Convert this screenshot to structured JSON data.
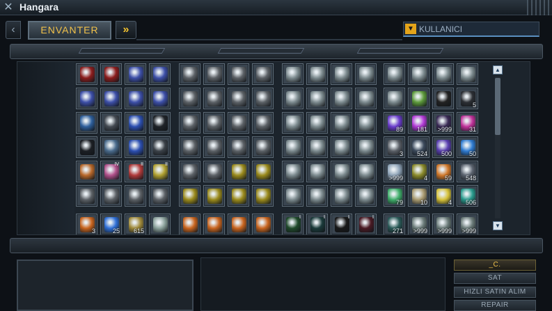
{
  "window": {
    "title": "Hangara"
  },
  "nav": {
    "tab_label": "ENVANTER",
    "prev_icon": "‹",
    "next_icon": "»"
  },
  "user_filter": {
    "label": "KULLANICI"
  },
  "actions": {
    "primary": "_C.",
    "sell": "SAT",
    "quick_buy": "HIZLI SATIN ALIM",
    "repair": "REPAIR"
  },
  "colors": {
    "accent": "#f0c14a",
    "slot_border": "#5f6d79",
    "panel": "#1c242c"
  },
  "inventory": {
    "rows": [
      [
        {
          "icon": "red-book-icon",
          "color": "#8c1d1d"
        },
        {
          "icon": "red-book-icon",
          "color": "#8c1d1d"
        },
        {
          "icon": "blue-drone-icon",
          "color": "#3d4fa8"
        },
        {
          "icon": "blue-drone-icon",
          "color": "#3d4fa8"
        },
        {
          "icon": "generator-icon",
          "color": "#5c6166"
        },
        {
          "icon": "generator-icon",
          "color": "#5c6166"
        },
        {
          "icon": "generator-icon",
          "color": "#5c6166"
        },
        {
          "icon": "generator-icon",
          "color": "#5c6166"
        },
        {
          "icon": "laser-cannon-icon",
          "color": "#7c8a8e"
        },
        {
          "icon": "laser-cannon-icon",
          "color": "#7c8a8e"
        },
        {
          "icon": "laser-cannon-icon",
          "color": "#7c8a8e"
        },
        {
          "icon": "laser-cannon-icon",
          "color": "#7c8a8e"
        },
        {
          "icon": "laser-cannon-icon",
          "color": "#7c8a8e"
        },
        {
          "icon": "laser-cannon-icon",
          "color": "#7c8a8e"
        },
        {
          "icon": "laser-cannon-icon",
          "color": "#7c8a8e"
        },
        {
          "icon": "laser-cannon-icon",
          "color": "#7c8a8e"
        }
      ],
      [
        {
          "icon": "blue-drone-icon",
          "color": "#3d4fa8"
        },
        {
          "icon": "blue-drone-icon",
          "color": "#3d4fa8"
        },
        {
          "icon": "blue-drone-icon",
          "color": "#3d4fa8"
        },
        {
          "icon": "blue-drone-icon",
          "color": "#3d4fa8"
        },
        {
          "icon": "generator-icon",
          "color": "#5c6166"
        },
        {
          "icon": "generator-icon",
          "color": "#5c6166"
        },
        {
          "icon": "generator-icon",
          "color": "#5c6166"
        },
        {
          "icon": "generator-icon",
          "color": "#5c6166"
        },
        {
          "icon": "laser-cannon-icon",
          "color": "#7c8a8e"
        },
        {
          "icon": "laser-cannon-icon",
          "color": "#7c8a8e"
        },
        {
          "icon": "laser-cannon-icon",
          "color": "#7c8a8e"
        },
        {
          "icon": "laser-cannon-icon",
          "color": "#7c8a8e"
        },
        {
          "icon": "laser-cannon-icon",
          "color": "#7c8a8e"
        },
        {
          "icon": "green-cpu-icon",
          "color": "#5d9a3b"
        },
        {
          "icon": "black-module-icon",
          "color": "#222222"
        },
        {
          "icon": "magnet-icon",
          "color": "#2c2f34",
          "count": "5"
        }
      ],
      [
        {
          "icon": "drone-formation-icon",
          "color": "#2e5f9c"
        },
        {
          "icon": "spider-drone-icon",
          "color": "#444a52"
        },
        {
          "icon": "blue-chip-icon",
          "color": "#2c4fb1"
        },
        {
          "icon": "dark-box-icon",
          "color": "#1f2328"
        },
        {
          "icon": "generator-icon",
          "color": "#5c6166"
        },
        {
          "icon": "generator-icon",
          "color": "#5c6166"
        },
        {
          "icon": "generator-icon",
          "color": "#5c6166"
        },
        {
          "icon": "generator-icon",
          "color": "#5c6166"
        },
        {
          "icon": "laser-cannon-icon",
          "color": "#7c8a8e"
        },
        {
          "icon": "laser-cannon-icon",
          "color": "#7c8a8e"
        },
        {
          "icon": "laser-cannon-icon",
          "color": "#7c8a8e"
        },
        {
          "icon": "laser-cannon-icon",
          "color": "#7c8a8e"
        },
        {
          "icon": "purple-crystal-icon",
          "color": "#6a3ccc",
          "count": "89"
        },
        {
          "icon": "violet-crystal-icon",
          "color": "#b23ad6",
          "count": "181"
        },
        {
          "icon": "dark-cargo-icon",
          "color": "#3a2a55",
          "count": ">999"
        },
        {
          "icon": "pink-crystal-icon",
          "color": "#c0329a",
          "count": "31"
        }
      ],
      [
        {
          "icon": "black-plate-icon",
          "color": "#1c1f24"
        },
        {
          "icon": "grid-chip-icon",
          "color": "#4a6b8c"
        },
        {
          "icon": "blue-chip-icon",
          "color": "#2c4fb1"
        },
        {
          "icon": "triangle-module-icon",
          "color": "#3b4148"
        },
        {
          "icon": "generator-icon",
          "color": "#5c6166"
        },
        {
          "icon": "generator-icon",
          "color": "#5c6166"
        },
        {
          "icon": "generator-icon",
          "color": "#5c6166"
        },
        {
          "icon": "generator-icon",
          "color": "#5c6166"
        },
        {
          "icon": "laser-cannon-icon",
          "color": "#7c8a8e"
        },
        {
          "icon": "laser-cannon-icon",
          "color": "#7c8a8e"
        },
        {
          "icon": "laser-cannon-icon",
          "color": "#7c8a8e"
        },
        {
          "icon": "laser-cannon-icon",
          "color": "#7c8a8e"
        },
        {
          "icon": "gray-ore-icon",
          "color": "#5a5f66",
          "count": "3"
        },
        {
          "icon": "rocket-pack-icon",
          "color": "#3c4a5c",
          "count": "524"
        },
        {
          "icon": "violet-shard-icon",
          "color": "#5a3fb0",
          "count": "500"
        },
        {
          "icon": "blue-crystal-icon",
          "color": "#2f7bd1",
          "count": "50"
        }
      ],
      [
        {
          "icon": "orange-drone-icon",
          "color": "#b8682a"
        },
        {
          "icon": "pink-ring-icon",
          "color": "#b0508a",
          "level": "IV"
        },
        {
          "icon": "red-ring-icon",
          "color": "#b03a3a",
          "level": "II"
        },
        {
          "icon": "yellow-ring-icon",
          "color": "#b0a030",
          "level": "II"
        },
        {
          "icon": "generator-icon",
          "color": "#5c6166"
        },
        {
          "icon": "generator-icon",
          "color": "#5c6166"
        },
        {
          "icon": "yellow-shield-gen-icon",
          "color": "#9a8a1c"
        },
        {
          "icon": "yellow-shield-gen-icon",
          "color": "#9a8a1c"
        },
        {
          "icon": "laser-cannon-icon",
          "color": "#7c8a8e"
        },
        {
          "icon": "laser-cannon-icon",
          "color": "#7c8a8e"
        },
        {
          "icon": "laser-cannon-icon",
          "color": "#7c8a8e"
        },
        {
          "icon": "laser-cannon-icon",
          "color": "#7c8a8e"
        },
        {
          "icon": "white-star-icon",
          "color": "#8fa4b8",
          "count": ">999"
        },
        {
          "icon": "yellow-ore-icon",
          "color": "#8a8a2a",
          "count": "4"
        },
        {
          "icon": "orange-ore-icon",
          "color": "#d0782a",
          "count": "59"
        },
        {
          "icon": "white-mine-icon",
          "color": "#5c6470",
          "count": "548"
        }
      ],
      [
        {
          "icon": "generator-icon",
          "color": "#5c6166"
        },
        {
          "icon": "generator-icon",
          "color": "#5c6166"
        },
        {
          "icon": "generator-icon",
          "color": "#5c6166"
        },
        {
          "icon": "generator-icon",
          "color": "#5c6166"
        },
        {
          "icon": "yellow-shield-gen-icon",
          "color": "#9a8a1c"
        },
        {
          "icon": "yellow-shield-gen-icon",
          "color": "#9a8a1c"
        },
        {
          "icon": "yellow-shield-gen-icon",
          "color": "#9a8a1c"
        },
        {
          "icon": "yellow-shield-gen-icon",
          "color": "#9a8a1c"
        },
        {
          "icon": "laser-cannon-icon",
          "color": "#7c8a8e"
        },
        {
          "icon": "laser-cannon-icon",
          "color": "#7c8a8e"
        },
        {
          "icon": "laser-cannon-icon",
          "color": "#7c8a8e"
        },
        {
          "icon": "laser-cannon-icon",
          "color": "#7c8a8e"
        },
        {
          "icon": "green-gem-icon",
          "color": "#3fae6a",
          "count": "79"
        },
        {
          "icon": "sand-ore-icon",
          "color": "#a89a70",
          "count": "10"
        },
        {
          "icon": "lightning-icon",
          "color": "#d6c23a",
          "count": "4"
        },
        {
          "icon": "teal-gem-icon",
          "color": "#2a9c8e",
          "count": "506"
        }
      ],
      [
        {
          "icon": "orange-card-icon",
          "color": "#c8641e",
          "count": "3"
        },
        {
          "icon": "blue-shield-icon",
          "color": "#2f6fd6",
          "count": "25"
        },
        {
          "icon": "yellow-pet-icon",
          "color": "#a08a3a",
          "count": "615"
        },
        {
          "icon": "map-icon",
          "color": "#8aa09a"
        },
        {
          "icon": "orange-x-booster-icon",
          "color": "#c8641e"
        },
        {
          "icon": "orange-x-booster-icon",
          "color": "#c8641e"
        },
        {
          "icon": "orange-x-booster-icon",
          "color": "#c8641e"
        },
        {
          "icon": "orange-x-booster-icon",
          "color": "#c8641e"
        },
        {
          "icon": "green-ship-design-icon",
          "color": "#1f4a2a",
          "level": "I"
        },
        {
          "icon": "teal-ship-design-icon",
          "color": "#1a3a3a",
          "level": "I"
        },
        {
          "icon": "black-ship-design-icon",
          "color": "#181818",
          "level": "I"
        },
        {
          "icon": "red-ship-design-icon",
          "color": "#4a1a24",
          "level": "I"
        },
        {
          "icon": "green-extra-icon",
          "color": "#2a5a58",
          "count": "271"
        },
        {
          "icon": "white-ammo-icon",
          "color": "#6a7a78",
          "count": ">999"
        },
        {
          "icon": "white-ammo-icon",
          "color": "#6a7a78",
          "count": ">999"
        },
        {
          "icon": "white-ammo-icon",
          "color": "#6a7a78",
          "count": ">999"
        }
      ]
    ]
  }
}
